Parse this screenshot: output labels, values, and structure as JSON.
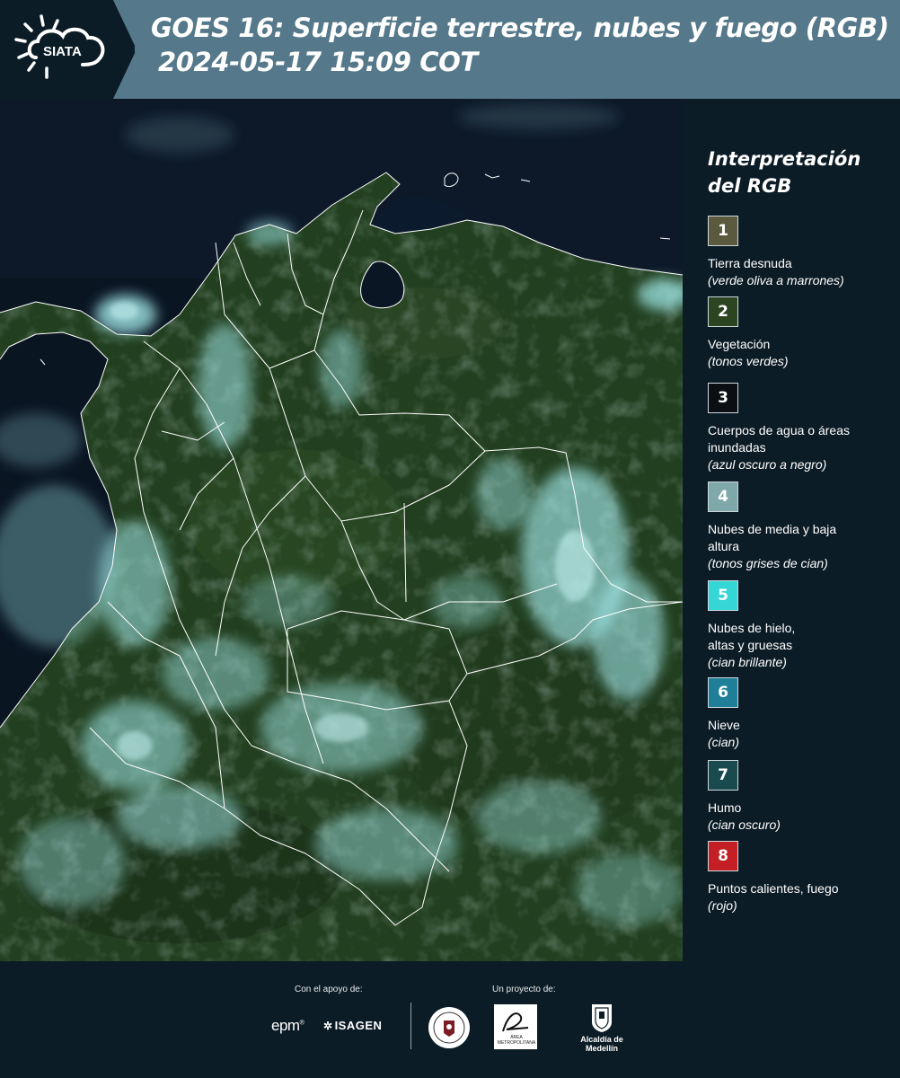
{
  "header": {
    "logo_text": "SIATA",
    "title_line1": "GOES 16: Superficie terrestre, nubes y fuego (RGB)",
    "title_line2": "2024-05-17 15:09 COT"
  },
  "legend": {
    "title": "Interpretación del RGB",
    "items": [
      {
        "number": "1",
        "label": "Tierra desnuda",
        "desc": "(verde oliva a marrones)",
        "color": "#5b5a3e"
      },
      {
        "number": "2",
        "label": "Vegetación",
        "desc": "(tonos verdes)",
        "color": "#2d4421"
      },
      {
        "number": "3",
        "label": "Cuerpos de agua o áreas inundadas",
        "desc": "(azul oscuro a negro)",
        "color": "#0b0f14"
      },
      {
        "number": "4",
        "label": "Nubes de media y baja altura",
        "desc": "(tonos grises de cian)",
        "color": "#7fa8aa"
      },
      {
        "number": "5",
        "label": "Nubes de hielo, altas y gruesas",
        "desc": "(cian brillante)",
        "color": "#35d6d6"
      },
      {
        "number": "6",
        "label": "Nieve",
        "desc": "(cian)",
        "color": "#1f7f98"
      },
      {
        "number": "7",
        "label": "Humo",
        "desc": "(cian oscuro)",
        "color": "#184a4e"
      },
      {
        "number": "8",
        "label": "Puntos calientes, fuego",
        "desc": "(rojo)",
        "color": "#c31f24"
      }
    ]
  },
  "footer": {
    "support_caption": "Con el apoyo de:",
    "project_caption": "Un proyecto de:",
    "epm_text": "epm",
    "isagen_text": "ISAGEN",
    "amva_text": "ÁREA METROPOLITANA",
    "alcaldia_text": "Alcaldía de Medellín"
  }
}
